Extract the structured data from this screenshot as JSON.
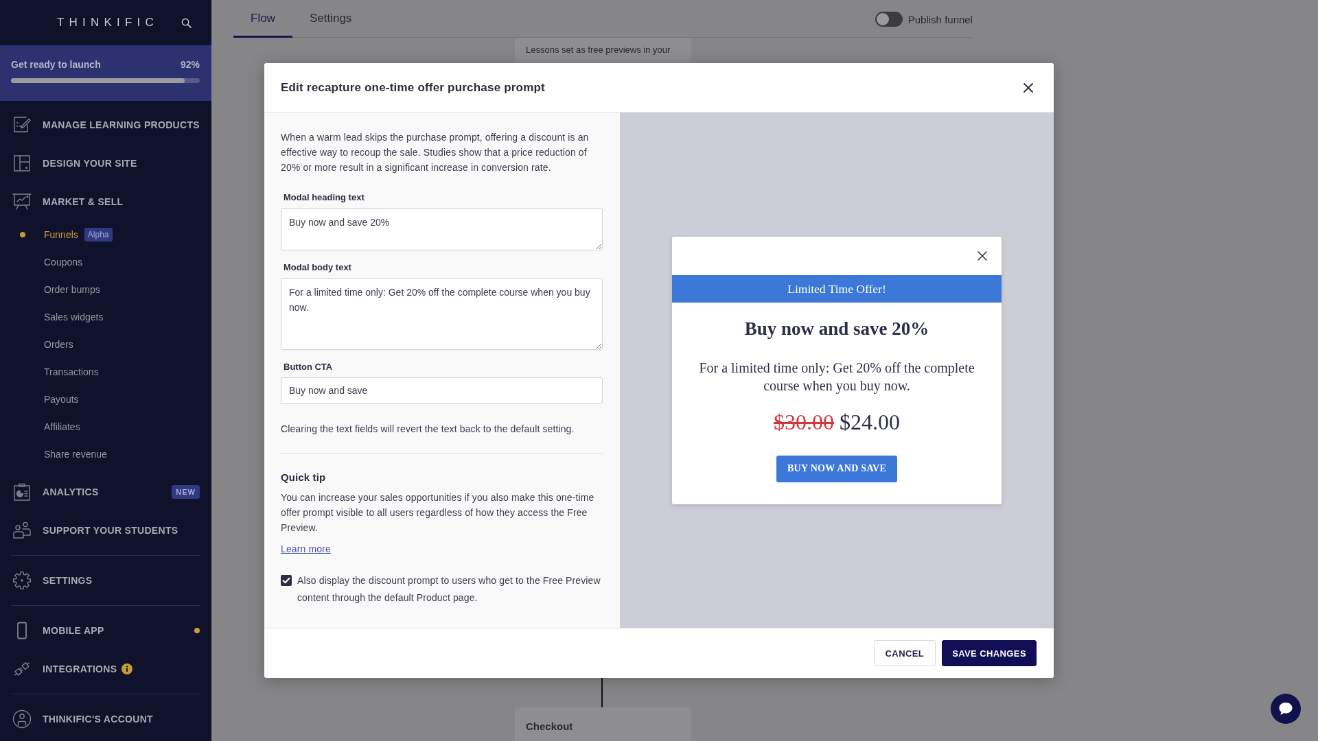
{
  "sidebar": {
    "logo": "THINKIFIC",
    "launch": {
      "label": "Get ready to launch",
      "percent": "92%",
      "level": 0.92
    },
    "groups": [
      {
        "items": [
          {
            "label": "MANAGE LEARNING PRODUCTS"
          },
          {
            "label": "DESIGN YOUR SITE"
          },
          {
            "label": "MARKET & SELL",
            "children": [
              {
                "label": "Funnels",
                "selected": true,
                "badge": "Alpha"
              },
              {
                "label": "Coupons",
                "selected": false
              },
              {
                "label": "Order bumps",
                "selected": false
              },
              {
                "label": "Sales widgets",
                "selected": false
              },
              {
                "label": "Orders",
                "selected": false
              },
              {
                "label": "Transactions",
                "selected": false
              },
              {
                "label": "Payouts",
                "selected": false
              },
              {
                "label": "Affiliates",
                "selected": false
              },
              {
                "label": "Share revenue",
                "selected": false
              }
            ]
          },
          {
            "label": "ANALYTICS",
            "badge": "NEW"
          },
          {
            "label": "SUPPORT YOUR STUDENTS"
          }
        ]
      },
      {
        "items": [
          {
            "label": "SETTINGS"
          }
        ]
      },
      {
        "items": [
          {
            "label": "MOBILE APP",
            "notification": true,
            "info": false
          },
          {
            "label": "INTEGRATIONS",
            "notification": false,
            "info": true
          }
        ]
      },
      {
        "items": [
          {
            "label": "THINKIFIC'S ACCOUNT"
          }
        ]
      }
    ]
  },
  "main": {
    "tabs": [
      {
        "label": "Flow",
        "selected": true
      },
      {
        "label": "Settings",
        "selected": false
      }
    ],
    "publish": {
      "label": "Publish funnel",
      "on": false
    },
    "flow": {
      "nodes": [
        {
          "kind": "note",
          "text": "Lessons set as free previews in your"
        },
        {
          "kind": "step",
          "text": "Checkout"
        }
      ]
    }
  },
  "modal": {
    "title": "Edit recapture one-time offer purchase prompt",
    "intro": "When a warm lead skips the purchase prompt, offering a discount is an effective way to recoup the sale. Studies show that a price reduction of 20% or more result in a significant increase in conversion rate.",
    "fields": [
      {
        "kind": "textarea",
        "label": "Modal heading text",
        "value": "Buy now and save 20%"
      },
      {
        "kind": "textarea",
        "label": "Modal body text",
        "value": "For a limited time only: Get 20% off the complete course when you buy now."
      },
      {
        "kind": "input",
        "label": "Button CTA",
        "value": "Buy now and save"
      }
    ],
    "note": "Clearing the text fields will revert the text back to the default setting.",
    "tip": {
      "title": "Quick tip",
      "text": "You can increase your sales opportunities if you also make this one-time offer prompt visible to all users regardless of how they access the Free Preview.",
      "link": "Learn more"
    },
    "option": {
      "label": "Also display the discount prompt to users who get to the Free Preview content through the default Product page.",
      "checked": true
    },
    "preview": {
      "banner": "Limited Time Offer!",
      "heading": "Buy now and save 20%",
      "body": "For a limited time only: Get 20% off the complete course when you buy now.",
      "old_price": "$30.00",
      "price": "$24.00",
      "button": "BUY NOW AND SAVE"
    },
    "buttons": [
      {
        "kind": "secondary",
        "label": "CANCEL"
      },
      {
        "kind": "primary",
        "label": "SAVE CHANGES"
      }
    ]
  }
}
